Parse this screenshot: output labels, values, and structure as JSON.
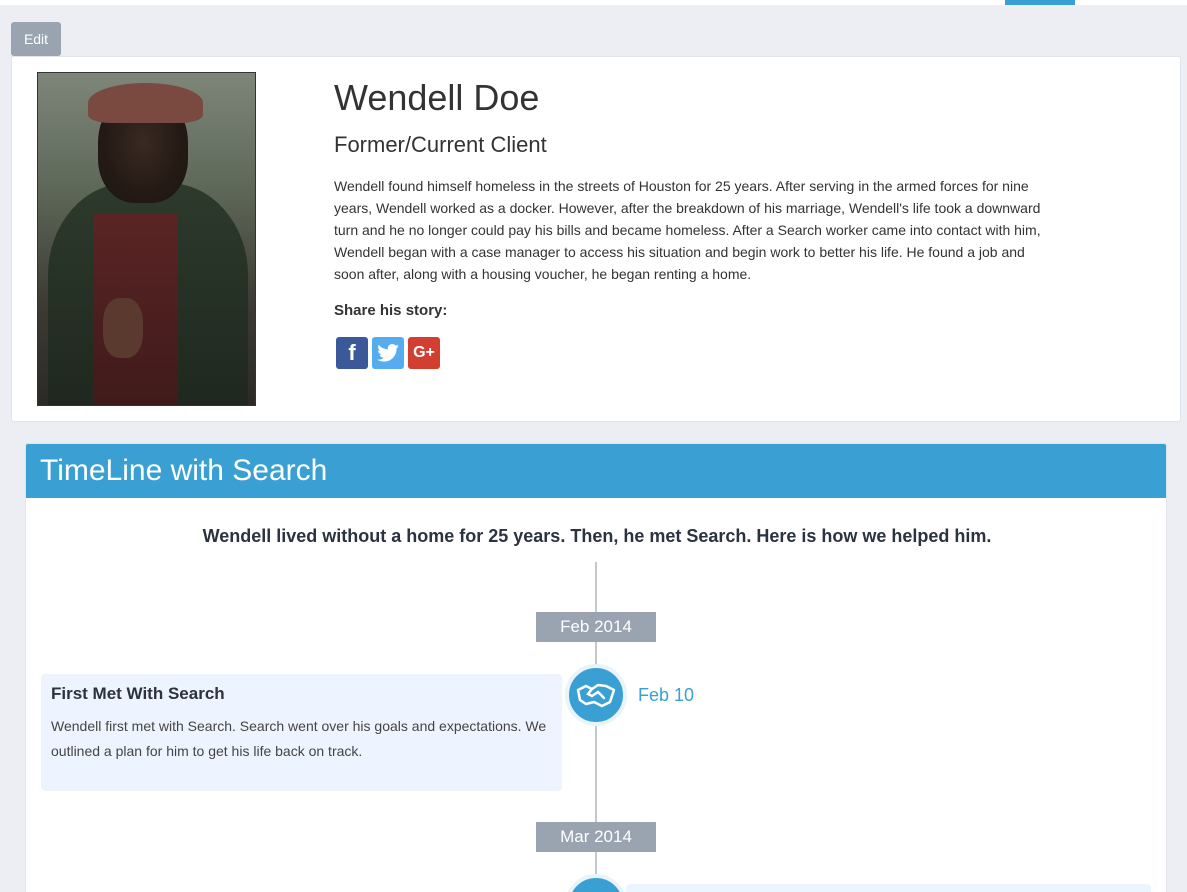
{
  "colors": {
    "accent": "#3aa0d4",
    "muted_button": "#9aa3b0",
    "event_bg": "#eef4ff"
  },
  "toolbar": {
    "edit_label": "Edit"
  },
  "profile": {
    "name": "Wendell Doe",
    "role": "Former/Current Client",
    "story": "Wendell found himself homeless in the streets of Houston for 25 years. After serving in the armed forces for nine years, Wendell worked as a docker. However, after the breakdown of his marriage, Wendell's life took a downward turn and he no longer could pay his bills and became homeless. After a Search worker came into contact with him, Wendell began with a case manager to access his situation and begin work to better his life. He found a job and soon after, along with a housing voucher, he began renting a home.",
    "share_label": "Share his story:",
    "social": [
      {
        "icon": "facebook-icon",
        "glyph": "f"
      },
      {
        "icon": "twitter-icon",
        "glyph": ""
      },
      {
        "icon": "google-plus-icon",
        "glyph": "G+"
      }
    ]
  },
  "timeline": {
    "title": "TimeLine with Search",
    "intro": "Wendell lived without a home for 25 years. Then, he met Search. Here is how we helped him.",
    "months": [
      "Feb 2014",
      "Mar 2014"
    ],
    "events": [
      {
        "icon": "handshake-icon",
        "date": "Feb 10",
        "title": "First Met With Search",
        "text": "Wendell first met with Search. Search went over his goals and expectations. We outlined a plan for him to get his life back on track."
      },
      {
        "icon": "document-icon"
      }
    ]
  }
}
